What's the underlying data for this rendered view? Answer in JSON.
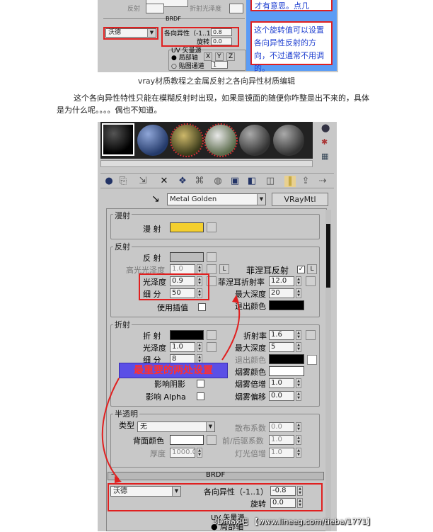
{
  "top_shot": {
    "blue_line1": "才有意思。点几",
    "note": "这个旋转值可以设置各向异性反射的方向，不过通常不用调的。",
    "brdf_label": "BRDF",
    "brdf_combo": "沃德",
    "aniso_label": "各向异性（-1..1）",
    "aniso_value": "0.8",
    "rotate_label": "旋转",
    "rotate_value": "0.0",
    "uv_label": "UV 矢量源",
    "local_axis": "局部轴",
    "axis_x": "X",
    "axis_y": "Y",
    "axis_z": "Z",
    "map_channel": "贴图通道",
    "map_channel_value": "1",
    "misc1": "反射",
    "misc2": "折射光泽度"
  },
  "caption": "vray材质教程之金属反射之各向异性材质编辑",
  "paragraph": {
    "line1": "这个各向异性特性只能在模糊反射时出现，如果是镜面的随便你咋整是出不来的，具体",
    "line2": "是为什么呢。。。。偶也不知道。"
  },
  "editor": {
    "material_name": "Metal Golden",
    "material_type": "VRayMtl",
    "diffuse": {
      "title": "漫射",
      "label": "漫 射",
      "color": "#f4cf2e"
    },
    "reflection": {
      "title": "反射",
      "reflect_label": "反 射",
      "hilight_label": "高光光泽度",
      "hilight_value": "1.0",
      "l_button": "L",
      "fresnel_label": "菲涅耳反射",
      "fresnel_check": "✓",
      "fresnel_l": "L",
      "gloss_label": "光泽度",
      "gloss_value": "0.9",
      "fresnel_ior_label": "菲涅耳折射率",
      "fresnel_ior_value": "12.0",
      "subdiv_label": "细 分",
      "subdiv_value": "50",
      "max_depth_label": "最大深度",
      "max_depth_value": "20",
      "interp_label": "使用插值",
      "exit_label": "退出颜色"
    },
    "refraction": {
      "title": "折射",
      "refract_label": "折 射",
      "ior_label": "折射率",
      "ior_value": "1.6",
      "gloss_label": "光泽度",
      "gloss_value": "1.0",
      "max_depth_label": "最大深度",
      "max_depth_value": "5",
      "subdiv_label": "细 分",
      "subdiv_value": "8",
      "exit_label": "退出颜色",
      "fog_color_label": "烟雾颜色",
      "shadow_label": "影响阴影",
      "fog_mult_label": "烟雾倍增",
      "fog_mult_value": "1.0",
      "alpha_label": "影响 Alpha",
      "fog_bias_label": "烟雾偏移",
      "fog_bias_value": "0.0"
    },
    "annotation": "最重要的两处设置",
    "translucency": {
      "title": "半透明",
      "type_label": "类型",
      "type_value": "无",
      "scatter_label": "散布系数",
      "scatter_value": "0.0",
      "back_label": "背面颜色",
      "fb_label": "前/后驱系数",
      "fb_value": "1.0",
      "thick_label": "厚度",
      "thick_value": "1000.0",
      "light_label": "灯光倍增",
      "light_value": "1.0"
    },
    "brdf": {
      "title": "BRDF",
      "combo": "沃德",
      "aniso_label": "各向异性（-1..1）",
      "aniso_value": "-0.8",
      "rotate_label": "旋转",
      "rotate_value": "0.0",
      "uv_label": "UV 矢量源",
      "local_label": "局部轴"
    },
    "watermark": "3Dmax吧 【www.lineeg.com/tieba/1771】"
  }
}
